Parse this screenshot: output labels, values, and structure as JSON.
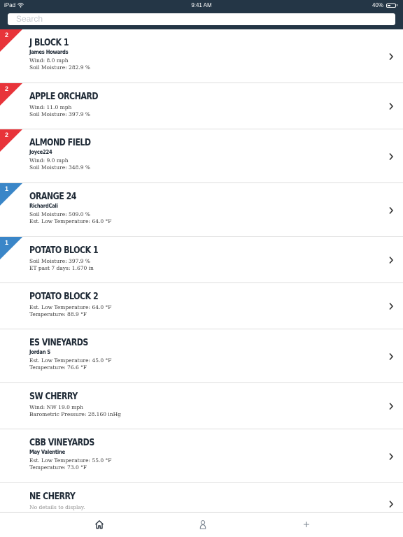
{
  "status_bar": {
    "carrier": "iPad",
    "time": "9:41 AM",
    "battery": "40%",
    "battery_level": 0.4
  },
  "search": {
    "placeholder": "Search"
  },
  "colors": {
    "header_bg": "#243646",
    "alert_red": "#e8343a",
    "alert_blue": "#3a86c8"
  },
  "items": [
    {
      "title": "J BLOCK 1",
      "owner": "James Howards",
      "details": [
        "Wind:  8.0 mph",
        "Soil Moisture: 282.9 %"
      ],
      "alert_count": "2",
      "alert_color": "red"
    },
    {
      "title": "APPLE ORCHARD",
      "owner": "",
      "details": [
        "Wind:  11.0 mph",
        "Soil Moisture: 397.9 %"
      ],
      "alert_count": "2",
      "alert_color": "red"
    },
    {
      "title": "ALMOND FIELD",
      "owner": "Joyce224",
      "details": [
        "Wind:  9.0 mph",
        "Soil Moisture: 348.9 %"
      ],
      "alert_count": "2",
      "alert_color": "red"
    },
    {
      "title": "ORANGE 24",
      "owner": "RichardCali",
      "details": [
        "Soil Moisture: 509.0 %",
        "Est. Low Temperature: 64.0 °F"
      ],
      "alert_count": "1",
      "alert_color": "blue"
    },
    {
      "title": "POTATO BLOCK 1",
      "owner": "",
      "details": [
        "Soil Moisture: 397.9 %",
        "ET past 7 days: 1.670 in"
      ],
      "alert_count": "1",
      "alert_color": "blue"
    },
    {
      "title": "POTATO BLOCK 2",
      "owner": "",
      "details": [
        "Est. Low Temperature: 64.0 °F",
        "Temperature: 88.9 °F"
      ],
      "alert_count": "",
      "alert_color": ""
    },
    {
      "title": "ES VINEYARDS",
      "owner": "Jordan S",
      "details": [
        "Est. Low Temperature: 45.0 °F",
        "Temperature: 76.6 °F"
      ],
      "alert_count": "",
      "alert_color": ""
    },
    {
      "title": "SW CHERRY",
      "owner": "",
      "details": [
        "Wind: NW 19.0 mph",
        "Barometric Pressure: 28.160 inHg"
      ],
      "alert_count": "",
      "alert_color": ""
    },
    {
      "title": "CBB VINEYARDS",
      "owner": "May Valentine",
      "details": [
        "Est. Low Temperature: 55.0 °F",
        "Temperature: 73.0 °F"
      ],
      "alert_count": "",
      "alert_color": ""
    },
    {
      "title": "NE  CHERRY",
      "owner": "",
      "details": [
        "No details to display."
      ],
      "alert_count": "",
      "alert_color": "",
      "empty": true
    }
  ],
  "tabbar": {
    "tabs": [
      "home-icon",
      "person-icon",
      "plus-icon"
    ],
    "active": "home-icon"
  }
}
